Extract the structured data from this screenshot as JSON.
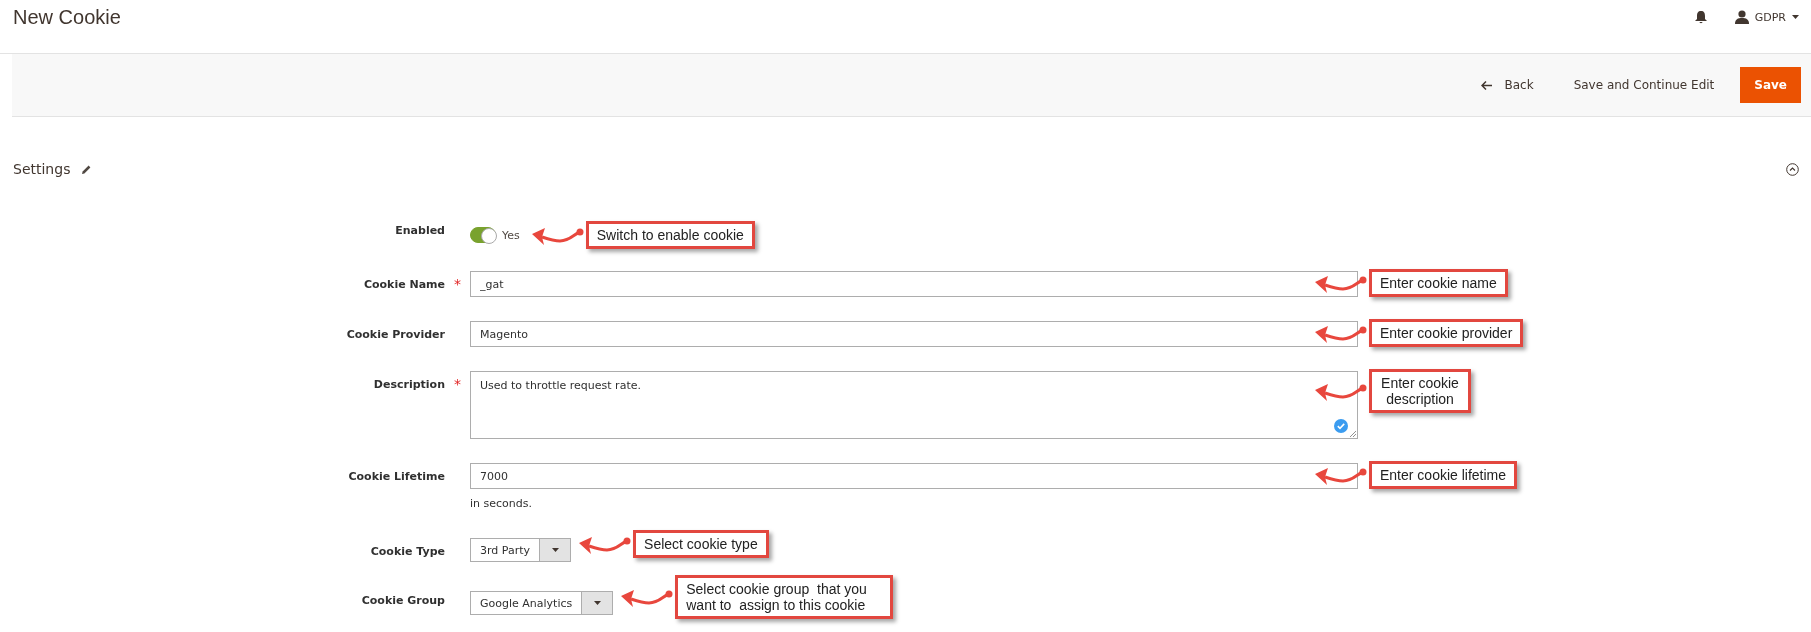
{
  "page": {
    "title": "New Cookie"
  },
  "header": {
    "user": "GDPR"
  },
  "required_symbol": "*",
  "actions": [
    {
      "kind": "back",
      "label": "Back"
    },
    {
      "kind": "secondary",
      "label": "Save and Continue Edit"
    },
    {
      "kind": "primary",
      "label": "Save"
    }
  ],
  "section": {
    "title": "Settings",
    "expanded": true
  },
  "fields": [
    {
      "kind": "toggle",
      "label": "Enabled",
      "required": false,
      "on": true,
      "value": "Yes",
      "callout": "Switch to enable cookie"
    },
    {
      "kind": "text",
      "label": "Cookie Name",
      "required": true,
      "value": "_gat",
      "callout": "Enter cookie name"
    },
    {
      "kind": "text",
      "label": "Cookie Provider",
      "required": false,
      "value": "Magento",
      "callout": "Enter cookie provider"
    },
    {
      "kind": "textarea",
      "label": "Description",
      "required": true,
      "value": "Used to throttle request rate.",
      "callout": "Enter cookie description"
    },
    {
      "kind": "text",
      "label": "Cookie Lifetime",
      "required": false,
      "value": "7000",
      "note": "in seconds.",
      "callout": "Enter cookie lifetime"
    },
    {
      "kind": "select",
      "label": "Cookie Type",
      "required": false,
      "value": "3rd Party",
      "callout": "Select cookie type"
    },
    {
      "kind": "select",
      "label": "Cookie Group",
      "required": false,
      "value": "Google Analytics",
      "callout": "Select cookie group  that you want to  assign to this cookie"
    }
  ]
}
